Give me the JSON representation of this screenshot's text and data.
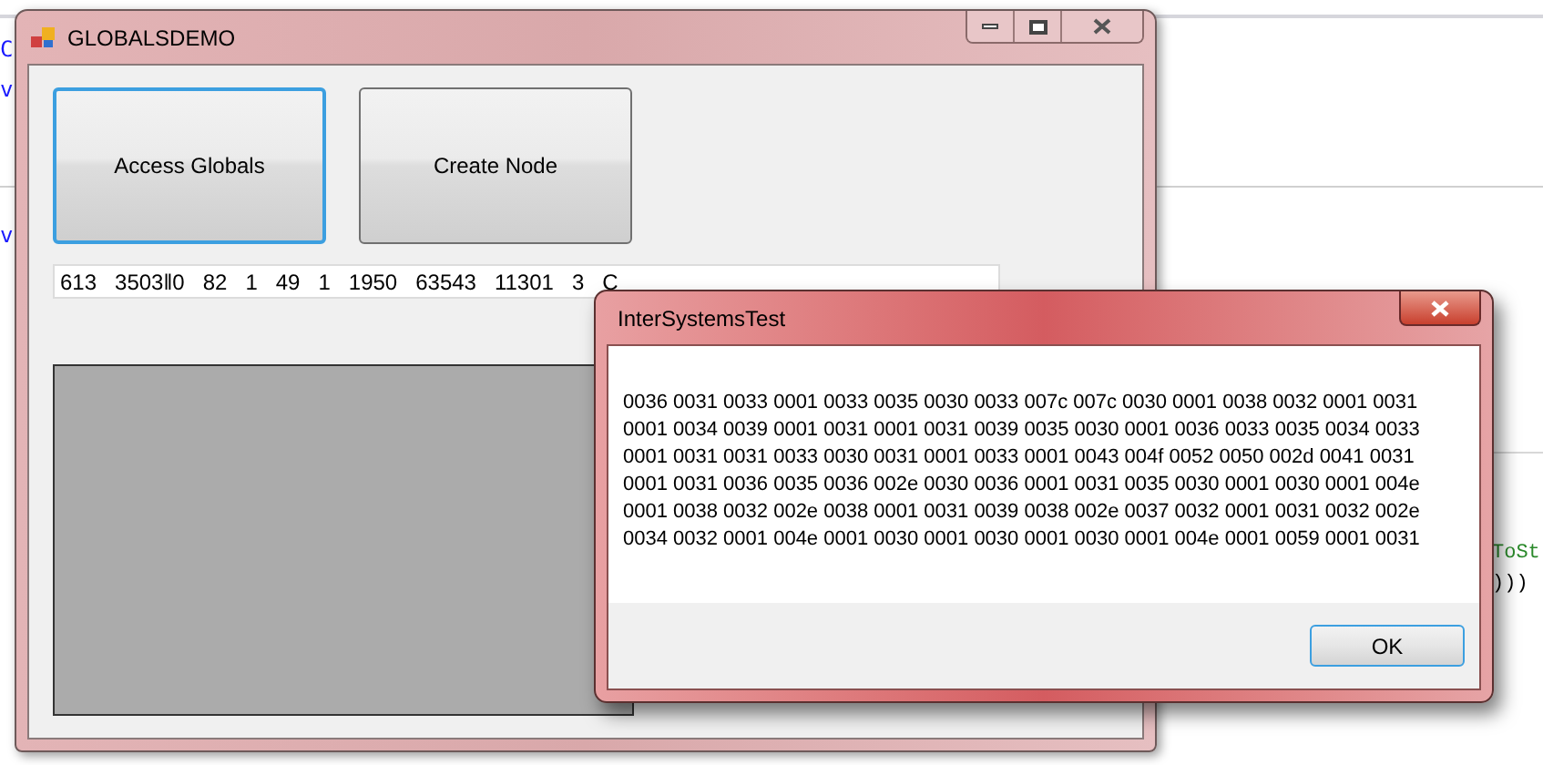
{
  "background_code": {
    "left_fragments": [
      "C",
      "v",
      "v"
    ],
    "right_fragments": [
      {
        "text": "ToSt",
        "kind": "green"
      },
      {
        "text": ")))",
        "kind": "plain"
      }
    ]
  },
  "main_window": {
    "title": "GLOBALSDEMO",
    "buttons": [
      {
        "label": "Access Globals",
        "focused": true
      },
      {
        "label": "Create Node",
        "focused": false
      }
    ],
    "output_field": {
      "value": "613   3503‖0   82   1   49   1   1950   63543   11301   3   C"
    }
  },
  "dialog": {
    "title": "InterSystemsTest",
    "message_lines": [
      "0036 0031 0033 0001 0033 0035 0030 0033 007c 007c 0030 0001 0038 0032 0001 0031",
      "0001 0034 0039 0001 0031 0001 0031 0039 0035 0030 0001 0036 0033 0035 0034 0033",
      "0001 0031 0031 0033 0030 0031 0001 0033 0001 0043 004f 0052 0050 002d 0041 0031",
      "0001 0031 0036 0035 0036 002e 0030 0036 0001 0031 0035 0030 0001 0030 0001 004e",
      "0001 0038 0032 002e 0038 0001 0031 0039 0038 002e 0037 0032 0001 0031 0032 002e",
      "0034 0032 0001 004e 0001 0030 0001 0030 0001 0030 0001 004e 0001 0059 0001 0031"
    ],
    "ok_button": "OK"
  }
}
